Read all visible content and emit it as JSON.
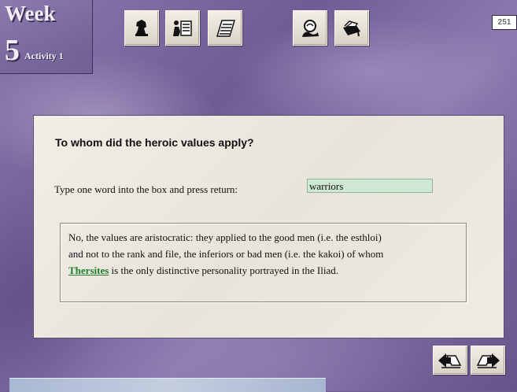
{
  "header": {
    "week_label": "Week",
    "week_number": "5",
    "activity_label": "Activity 1",
    "page_number": "251"
  },
  "toolbar": {
    "buttons": [
      {
        "name": "chess-knight-icon"
      },
      {
        "name": "study-notes-icon"
      },
      {
        "name": "notepad-icon"
      },
      {
        "name": "magnifier-icon"
      },
      {
        "name": "toolbox-icon"
      }
    ]
  },
  "panel": {
    "question": "To whom did the heroic values apply?",
    "prompt": "Type one word into the box and press return:",
    "answer_value": "warriors",
    "feedback": {
      "line1": "No, the values are aristocratic: they applied to the good men (i.e. the esthloi)",
      "line2": "and not to the rank and file, the inferiors or bad men (i.e. the kakoi) of whom",
      "link_text": "Thersites",
      "line3_rest": " is the only distinctive personality portrayed in the Iliad."
    }
  },
  "navigation": {
    "back_icon": "back-arrow-book-icon",
    "forward_icon": "forward-arrow-book-icon"
  },
  "colors": {
    "background": "#6d5a8e",
    "panel": "#ede9e0",
    "input_bg": "#cfe8d4",
    "link": "#1f7d2b"
  }
}
